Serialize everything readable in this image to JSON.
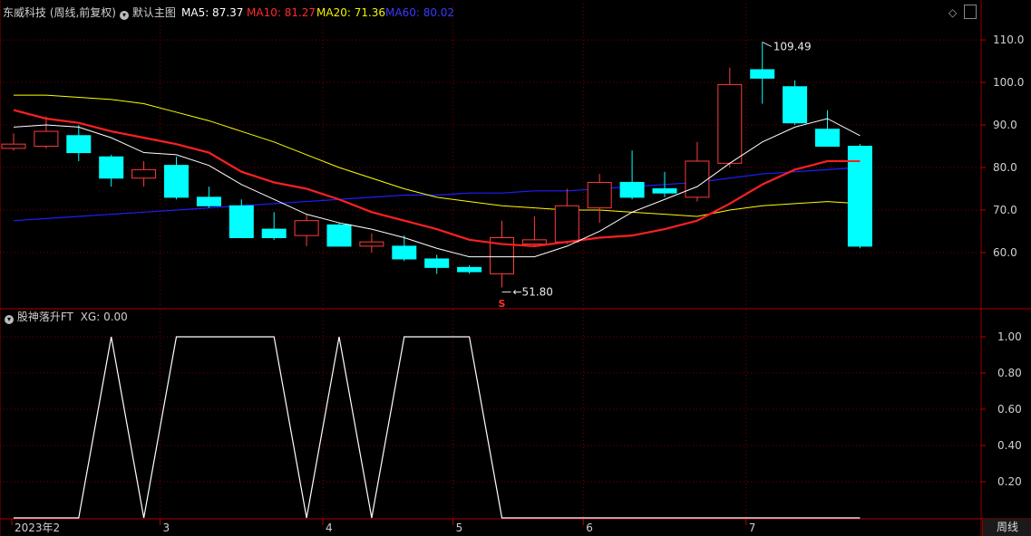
{
  "header": {
    "stock_title": "东威科技 (周线,前复权)",
    "main_chart_label": "默认主图",
    "ma5": "MA5: 87.37",
    "ma10": "MA10: 81.27",
    "ma20": "MA20: 71.36",
    "ma60": "MA60: 80.02"
  },
  "indicator": {
    "name": "股神落升FT",
    "value_text": "XG: 0.00"
  },
  "period_button": "周线",
  "colors": {
    "up": "#ff3b3b",
    "down": "#00ffff",
    "ma5": "#ffffff",
    "ma10": "#ff2020",
    "ma20": "#ffff00",
    "ma60": "#1e1eff",
    "grid": "#7a0000"
  },
  "chart_data": [
    {
      "type": "candlestick",
      "title": "东威科技 (周线,前复权)",
      "y_ticks": [
        "110.0",
        "100.0",
        "90.0",
        "80.0",
        "70.0",
        "60.0"
      ],
      "ylim": [
        47,
        113
      ],
      "x_tick_labels": [
        {
          "label": "2023年2",
          "index": 0
        },
        {
          "label": "3",
          "index": 5
        },
        {
          "label": "4",
          "index": 10
        },
        {
          "label": "5",
          "index": 14
        },
        {
          "label": "6",
          "index": 18
        },
        {
          "label": "7",
          "index": 23
        }
      ],
      "candles": [
        {
          "o": 84.5,
          "h": 88.0,
          "l": 84.0,
          "c": 85.5
        },
        {
          "o": 85.0,
          "h": 92.0,
          "l": 84.5,
          "c": 88.5
        },
        {
          "o": 87.5,
          "h": 90.0,
          "l": 81.5,
          "c": 83.5
        },
        {
          "o": 82.5,
          "h": 83.0,
          "l": 75.5,
          "c": 77.5
        },
        {
          "o": 77.5,
          "h": 81.5,
          "l": 75.5,
          "c": 79.5
        },
        {
          "o": 80.5,
          "h": 82.5,
          "l": 72.5,
          "c": 73.0
        },
        {
          "o": 73.0,
          "h": 75.5,
          "l": 70.5,
          "c": 71.0
        },
        {
          "o": 71.0,
          "h": 72.5,
          "l": 63.5,
          "c": 63.5
        },
        {
          "o": 65.5,
          "h": 69.5,
          "l": 63.0,
          "c": 63.5
        },
        {
          "o": 64.0,
          "h": 69.0,
          "l": 61.5,
          "c": 67.5
        },
        {
          "o": 66.5,
          "h": 67.0,
          "l": 61.5,
          "c": 61.5
        },
        {
          "o": 61.5,
          "h": 64.5,
          "l": 60.0,
          "c": 62.5
        },
        {
          "o": 61.5,
          "h": 64.0,
          "l": 58.0,
          "c": 58.5
        },
        {
          "o": 58.5,
          "h": 59.5,
          "l": 55.0,
          "c": 56.5
        },
        {
          "o": 56.5,
          "h": 57.0,
          "l": 55.0,
          "c": 55.5
        },
        {
          "o": 55.0,
          "h": 67.5,
          "l": 51.8,
          "c": 63.5
        },
        {
          "o": 62.0,
          "h": 68.5,
          "l": 61.5,
          "c": 63.0
        },
        {
          "o": 62.5,
          "h": 75.0,
          "l": 62.0,
          "c": 71.0
        },
        {
          "o": 70.5,
          "h": 78.5,
          "l": 67.0,
          "c": 76.5
        },
        {
          "o": 76.5,
          "h": 84.0,
          "l": 72.5,
          "c": 73.0
        },
        {
          "o": 75.0,
          "h": 79.0,
          "l": 73.0,
          "c": 74.0
        },
        {
          "o": 73.0,
          "h": 86.0,
          "l": 72.0,
          "c": 81.5
        },
        {
          "o": 81.0,
          "h": 103.5,
          "l": 80.0,
          "c": 99.5
        },
        {
          "o": 103.0,
          "h": 109.49,
          "l": 95.0,
          "c": 101.0
        },
        {
          "o": 99.0,
          "h": 100.5,
          "l": 90.0,
          "c": 90.5
        },
        {
          "o": 89.0,
          "h": 93.5,
          "l": 85.0,
          "c": 85.0
        },
        {
          "o": 85.0,
          "h": 85.5,
          "l": 61.0,
          "c": 61.5
        }
      ],
      "ma5": [
        89.5,
        90.0,
        89.5,
        87.0,
        83.5,
        83.0,
        80.5,
        76.0,
        72.5,
        69.0,
        67.0,
        65.5,
        63.5,
        61.0,
        59.0,
        59.0,
        59.0,
        61.5,
        65.0,
        69.5,
        72.5,
        75.5,
        81.0,
        86.0,
        89.5,
        91.5,
        87.5
      ],
      "ma10": [
        93.5,
        91.5,
        90.5,
        88.5,
        87.0,
        85.5,
        83.5,
        79.0,
        76.5,
        75.0,
        72.5,
        69.5,
        67.5,
        65.5,
        63.0,
        62.0,
        61.5,
        62.5,
        63.5,
        64.0,
        65.5,
        67.5,
        71.5,
        76.0,
        79.5,
        81.5,
        81.5
      ],
      "ma20": [
        97.0,
        97.0,
        96.5,
        96.0,
        95.0,
        93.0,
        91.0,
        88.5,
        86.0,
        83.0,
        80.0,
        77.5,
        75.0,
        73.0,
        72.0,
        71.0,
        70.5,
        70.0,
        70.0,
        69.5,
        69.0,
        68.5,
        70.0,
        71.0,
        71.5,
        72.0,
        71.5
      ],
      "ma60": [
        67.5,
        68.0,
        68.5,
        69.0,
        69.5,
        70.0,
        70.5,
        71.0,
        71.5,
        72.0,
        72.5,
        73.0,
        73.5,
        73.5,
        74.0,
        74.0,
        74.5,
        74.5,
        75.0,
        75.5,
        76.0,
        76.5,
        77.5,
        78.5,
        79.0,
        79.5,
        80.0
      ],
      "annotations": [
        {
          "label": "109.49",
          "index": 23,
          "value": 109.49,
          "position": "above"
        },
        {
          "label": "51.80",
          "index": 15,
          "value": 51.8,
          "position": "below"
        },
        {
          "label": "S",
          "index": 15,
          "position": "bottom"
        }
      ]
    },
    {
      "type": "line",
      "title": "股神落升FT",
      "series_name": "XG",
      "y_ticks": [
        "1.00",
        "0.80",
        "0.60",
        "0.40",
        "0.20"
      ],
      "ylim": [
        0,
        1.1
      ],
      "x": [
        0,
        2,
        3,
        4,
        5,
        8,
        9,
        10,
        11,
        12,
        14,
        15,
        26
      ],
      "values": [
        0,
        0,
        1,
        0,
        1,
        1,
        0,
        1,
        0,
        1,
        1,
        0,
        0
      ]
    }
  ]
}
